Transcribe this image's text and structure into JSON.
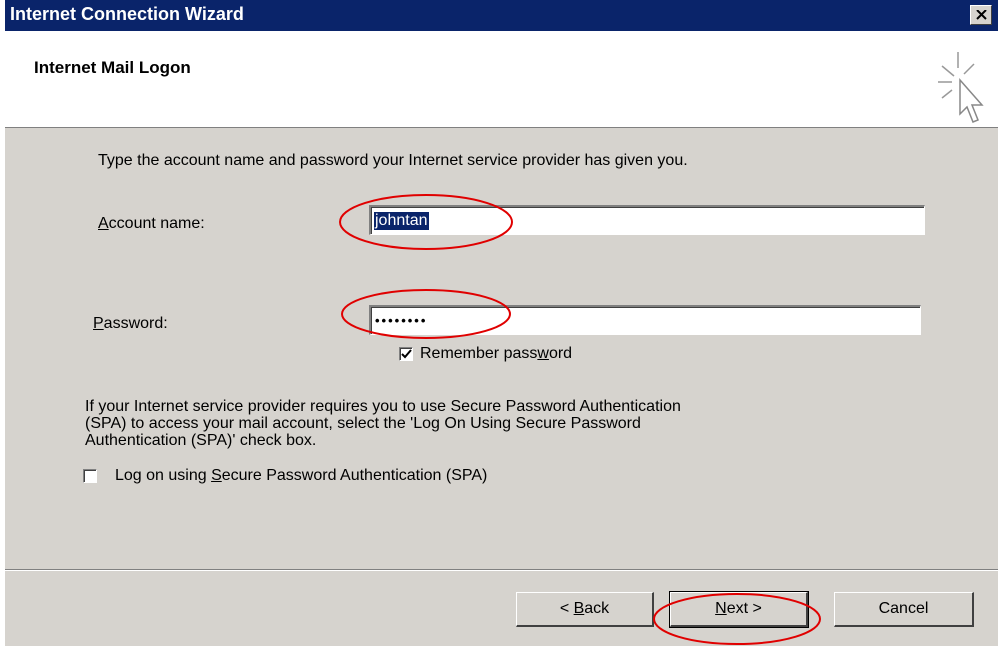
{
  "window": {
    "title": "Internet Connection Wizard",
    "close_glyph": "✕"
  },
  "header": {
    "title": "Internet Mail Logon",
    "icon": "wizard-cursor-icon"
  },
  "form": {
    "intro": "Type the account name and password your Internet service provider has given you.",
    "account_label_pre": "",
    "account_label_mnemonic": "A",
    "account_label_post": "ccount name:",
    "account_value": "johntan",
    "password_label_mnemonic": "P",
    "password_label_post": "assword:",
    "password_value": "••••••••",
    "remember_pre": "Remember pass",
    "remember_mnemonic": "w",
    "remember_post": "ord",
    "remember_checked": true,
    "spa_info_line1": "If your Internet service provider requires you to use Secure Password Authentication",
    "spa_info_line2": "(SPA) to access your mail account, select the 'Log On Using Secure Password",
    "spa_info_line3": "Authentication (SPA)' check box.",
    "spa_pre": "Log on using ",
    "spa_mnemonic": "S",
    "spa_post": "ecure Password Authentication (SPA)",
    "spa_checked": false
  },
  "buttons": {
    "back_pre": "< ",
    "back_mnemonic": "B",
    "back_post": "ack",
    "next_mnemonic": "N",
    "next_post": "ext >",
    "cancel": "Cancel"
  },
  "colors": {
    "titlebar": "#0a246a",
    "dialog": "#d6d3ce",
    "annotation": "#e00000"
  }
}
